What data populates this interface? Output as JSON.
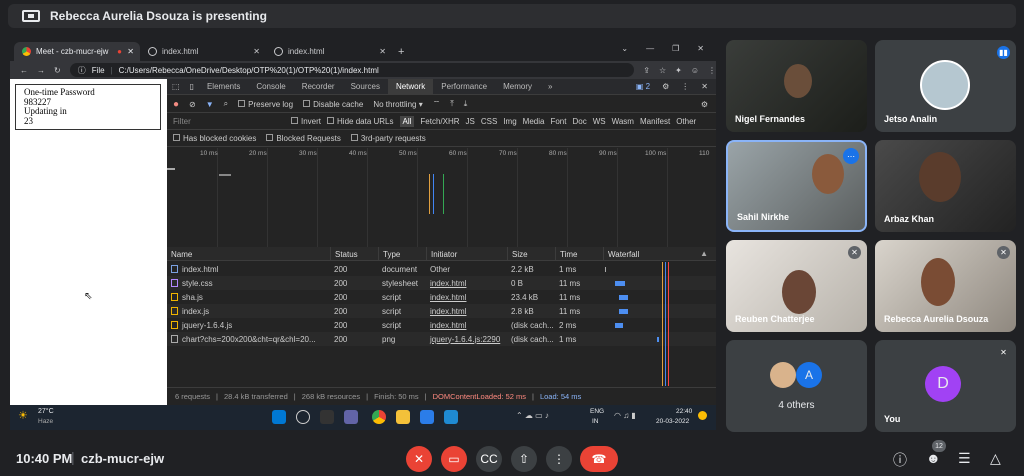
{
  "presenter": {
    "text": "Rebecca Aurelia Dsouza is presenting"
  },
  "browser": {
    "tabs": [
      {
        "label": "Meet - czb-mucr-ejw"
      },
      {
        "label": "index.html"
      },
      {
        "label": "index.html"
      }
    ],
    "url_prefix": "File",
    "url": "C:/Users/Rebecca/OneDrive/Desktop/OTP%20(1)/OTP%20(1)/index.html"
  },
  "page": {
    "line1": "One-time Password",
    "line2": "983227",
    "line3": "Updating in",
    "line4": "23"
  },
  "devtools": {
    "tabs": [
      "Elements",
      "Console",
      "Recorder",
      "Sources",
      "Network",
      "Performance",
      "Memory"
    ],
    "more": "»",
    "badge": "2",
    "toolbar": {
      "preserve_log": "Preserve log",
      "disable_cache": "Disable cache",
      "throttling": "No throttling"
    },
    "filter": {
      "placeholder": "Filter",
      "invert": "Invert",
      "hide_data_urls": "Hide data URLs",
      "types": [
        "All",
        "Fetch/XHR",
        "JS",
        "CSS",
        "Img",
        "Media",
        "Font",
        "Doc",
        "WS",
        "Wasm",
        "Manifest",
        "Other"
      ]
    },
    "blocked": {
      "cookies": "Has blocked cookies",
      "requests": "Blocked Requests",
      "third_party": "3rd-party requests"
    },
    "ticks": [
      "10 ms",
      "20 ms",
      "30 ms",
      "40 ms",
      "50 ms",
      "60 ms",
      "70 ms",
      "80 ms",
      "90 ms",
      "100 ms",
      "110"
    ],
    "columns": [
      "Name",
      "Status",
      "Type",
      "Initiator",
      "Size",
      "Time",
      "Waterfall"
    ],
    "rows": [
      {
        "name": "index.html",
        "status": "200",
        "type": "document",
        "initiator": "Other",
        "size": "2.2 kB",
        "time": "1 ms"
      },
      {
        "name": "style.css",
        "status": "200",
        "type": "stylesheet",
        "initiator": "index.html",
        "size": "0 B",
        "time": "11 ms"
      },
      {
        "name": "sha.js",
        "status": "200",
        "type": "script",
        "initiator": "index.html",
        "size": "23.4 kB",
        "time": "11 ms"
      },
      {
        "name": "index.js",
        "status": "200",
        "type": "script",
        "initiator": "index.html",
        "size": "2.8 kB",
        "time": "11 ms"
      },
      {
        "name": "jquery-1.6.4.js",
        "status": "200",
        "type": "script",
        "initiator": "index.html",
        "size": "(disk cach...",
        "time": "2 ms"
      },
      {
        "name": "chart?chs=200x200&cht=qr&chl=20...",
        "status": "200",
        "type": "png",
        "initiator": "jquery-1.6.4.js:2290",
        "size": "(disk cach...",
        "time": "1 ms"
      }
    ],
    "summary": {
      "requests": "6 requests",
      "transferred": "28.4 kB transferred",
      "resources": "268 kB resources",
      "finish": "Finish: 50 ms",
      "dcl": "DOMContentLoaded: 52 ms",
      "load": "Load: 54 ms"
    }
  },
  "taskbar": {
    "temp": "27°C",
    "weather": "Haze",
    "lang1": "ENG",
    "lang2": "IN",
    "time": "22:40",
    "date": "20-03-2022"
  },
  "participants": [
    {
      "name": "Nigel Fernandes"
    },
    {
      "name": "Jetso Analin"
    },
    {
      "name": "Sahil Nirkhe"
    },
    {
      "name": "Arbaz Khan"
    },
    {
      "name": "Reuben Chatterjee"
    },
    {
      "name": "Rebecca Aurelia Dsouza"
    },
    {
      "name": "4 others",
      "avatar": "A"
    },
    {
      "name": "You",
      "avatar": "D"
    }
  ],
  "meeting": {
    "time": "10:40 PM",
    "code": "czb-mucr-ejw",
    "people_badge": "12"
  },
  "colors": {
    "end_call": "#ea4335",
    "you_avatar": "#a142f4",
    "others_avatar": "#1a73e8",
    "pin_blue": "#1a73e8"
  }
}
